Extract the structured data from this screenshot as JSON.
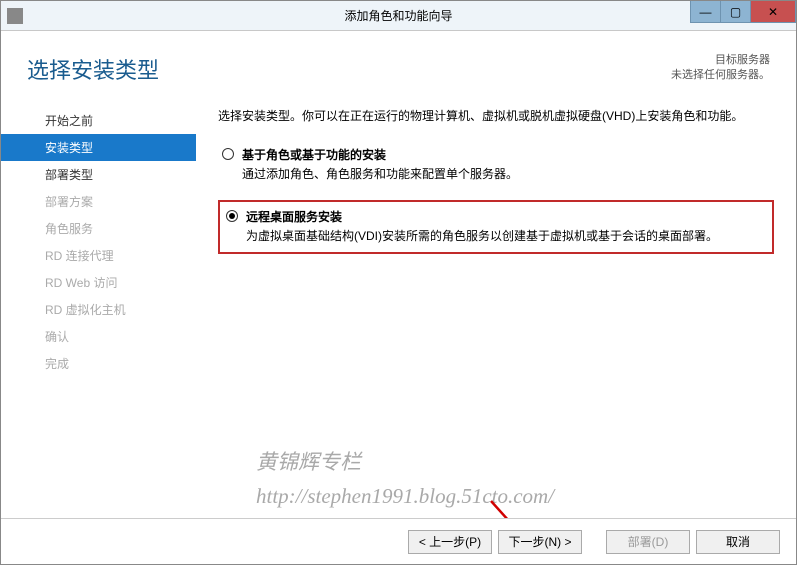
{
  "window": {
    "title": "添加角色和功能向导"
  },
  "header": {
    "page_title": "选择安装类型",
    "server_label": "目标服务器",
    "server_status": "未选择任何服务器。"
  },
  "sidebar": {
    "items": [
      {
        "label": "开始之前",
        "state": "enabled"
      },
      {
        "label": "安装类型",
        "state": "active"
      },
      {
        "label": "部署类型",
        "state": "enabled"
      },
      {
        "label": "部署方案",
        "state": "disabled"
      },
      {
        "label": "角色服务",
        "state": "disabled"
      },
      {
        "label": "RD 连接代理",
        "state": "disabled"
      },
      {
        "label": "RD Web 访问",
        "state": "disabled"
      },
      {
        "label": "RD 虚拟化主机",
        "state": "disabled"
      },
      {
        "label": "确认",
        "state": "disabled"
      },
      {
        "label": "完成",
        "state": "disabled"
      }
    ]
  },
  "main": {
    "instruction": "选择安装类型。你可以在正在运行的物理计算机、虚拟机或脱机虚拟硬盘(VHD)上安装角色和功能。",
    "options": [
      {
        "title": "基于角色或基于功能的安装",
        "desc": "通过添加角色、角色服务和功能来配置单个服务器。",
        "selected": false,
        "highlighted": false
      },
      {
        "title": "远程桌面服务安装",
        "desc": "为虚拟桌面基础结构(VDI)安装所需的角色服务以创建基于虚拟机或基于会话的桌面部署。",
        "selected": true,
        "highlighted": true
      }
    ]
  },
  "buttons": {
    "prev": "< 上一步(P)",
    "next": "下一步(N) >",
    "deploy": "部署(D)",
    "cancel": "取消"
  },
  "watermark": {
    "line1": "黄锦辉专栏",
    "line2": "http://stephen1991.blog.51cto.com/"
  }
}
